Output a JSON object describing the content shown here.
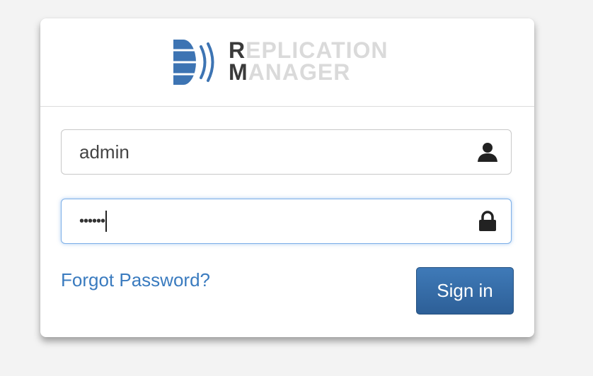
{
  "logo": {
    "line1_initial": "R",
    "line1_rest": "EPLICATION",
    "line2_initial": "M",
    "line2_rest": "ANAGER",
    "icon": "database-signal-icon",
    "brand_color": "#3d74b3"
  },
  "form": {
    "username": {
      "value": "admin",
      "icon": "user-icon"
    },
    "password": {
      "masked_value": "••••••",
      "icon": "lock-icon",
      "focused": true
    },
    "forgot_password_label": "Forgot Password?",
    "sign_in_label": "Sign in"
  },
  "colors": {
    "background": "#f3f3f3",
    "link": "#3a7bbf",
    "button": "#2d5f97",
    "focus_border": "#7eb0e8"
  }
}
